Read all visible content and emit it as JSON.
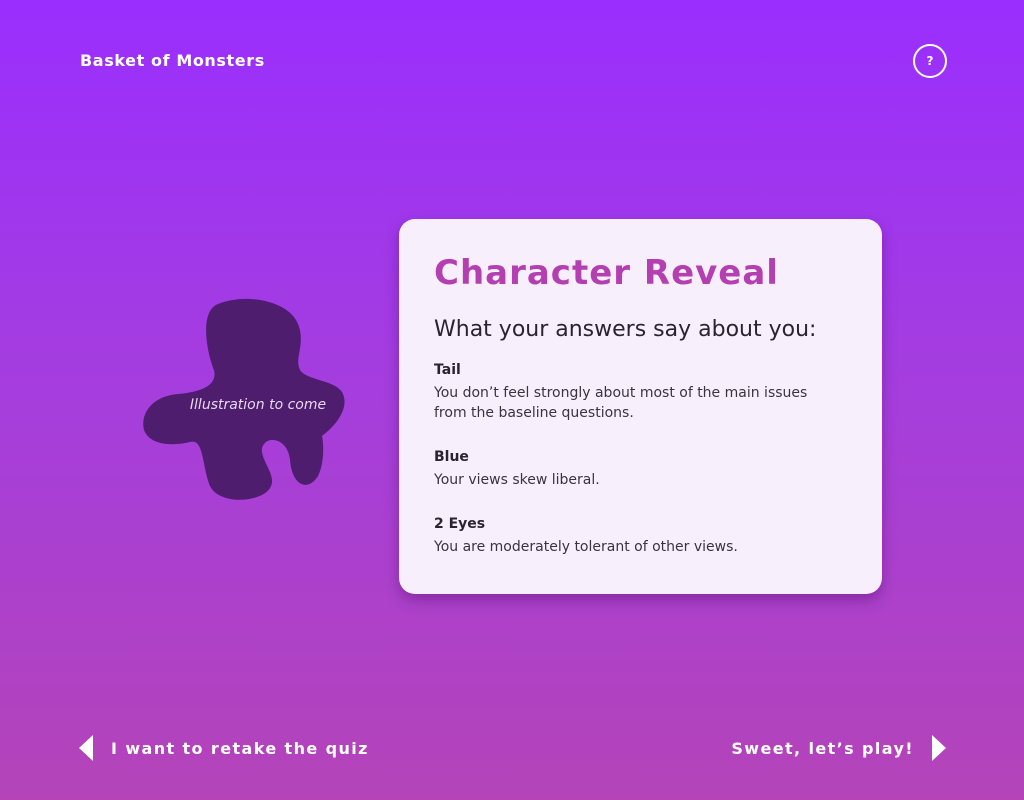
{
  "app": {
    "title": "Basket of Monsters",
    "help_label": "?"
  },
  "illustration": {
    "caption": "Illustration to come",
    "color": "#4e1d6e"
  },
  "card": {
    "title": "Character Reveal",
    "subtitle": "What your answers say about you:",
    "traits": [
      {
        "name": "Tail",
        "description": "You don’t feel strongly about most of the main issues from the baseline questions."
      },
      {
        "name": "Blue",
        "description": "Your views skew liberal."
      },
      {
        "name": "2 Eyes",
        "description": "You are moderately tolerant of other views."
      }
    ]
  },
  "nav": {
    "back_label": "I want to retake the quiz",
    "next_label": "Sweet, let’s play!"
  },
  "colors": {
    "accent": "#b43fb0",
    "background_top": "#9a2efe",
    "background_bottom": "#b444b8",
    "card_bg": "#f8effc"
  }
}
